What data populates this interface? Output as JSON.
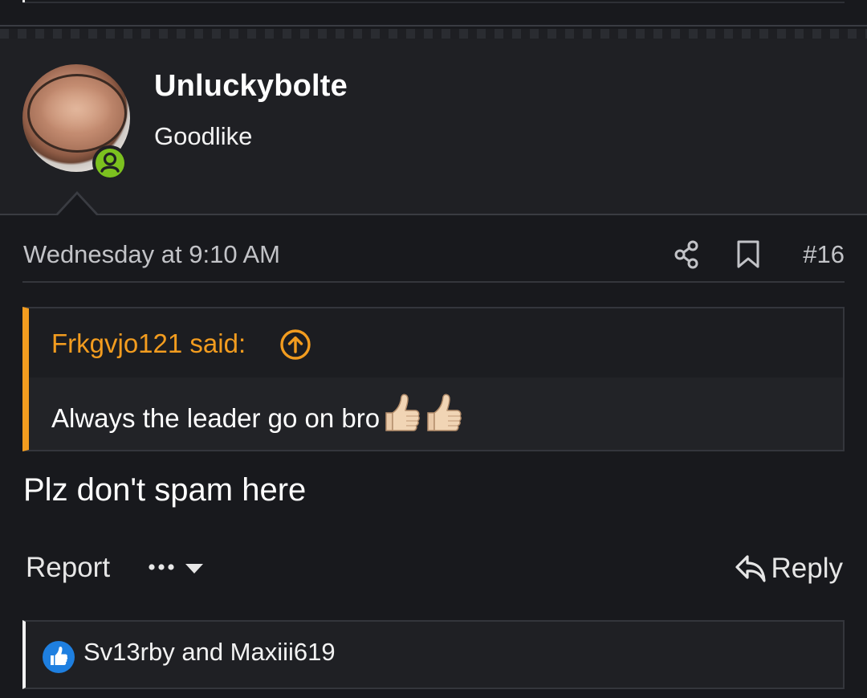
{
  "user": {
    "name": "Unluckybolte",
    "title": "Goodlike",
    "status": "online"
  },
  "post": {
    "date": "Wednesday at 9:10 AM",
    "number": "#16",
    "message": "Plz don't spam here"
  },
  "quote": {
    "author_said": "Frkgvjo121 said:",
    "text": "Always the leader go on bro",
    "emoji": [
      "thumbs-up",
      "thumbs-up"
    ]
  },
  "actions": {
    "report_label": "Report",
    "more_label": "•••",
    "reply_label": "Reply"
  },
  "reactions": {
    "users_text": "Sv13rby and Maxiii619",
    "type": "like"
  },
  "colors": {
    "background": "#18191d",
    "accent_orange": "#f29c1f",
    "online_green": "#7cc11f",
    "like_blue": "#1e7fe0"
  },
  "icons": [
    "share-icon",
    "bookmark-icon",
    "jump-to-quote-icon",
    "reply-icon",
    "like-icon",
    "user-icon",
    "caret-down-icon",
    "thumbs-up-emoji"
  ]
}
